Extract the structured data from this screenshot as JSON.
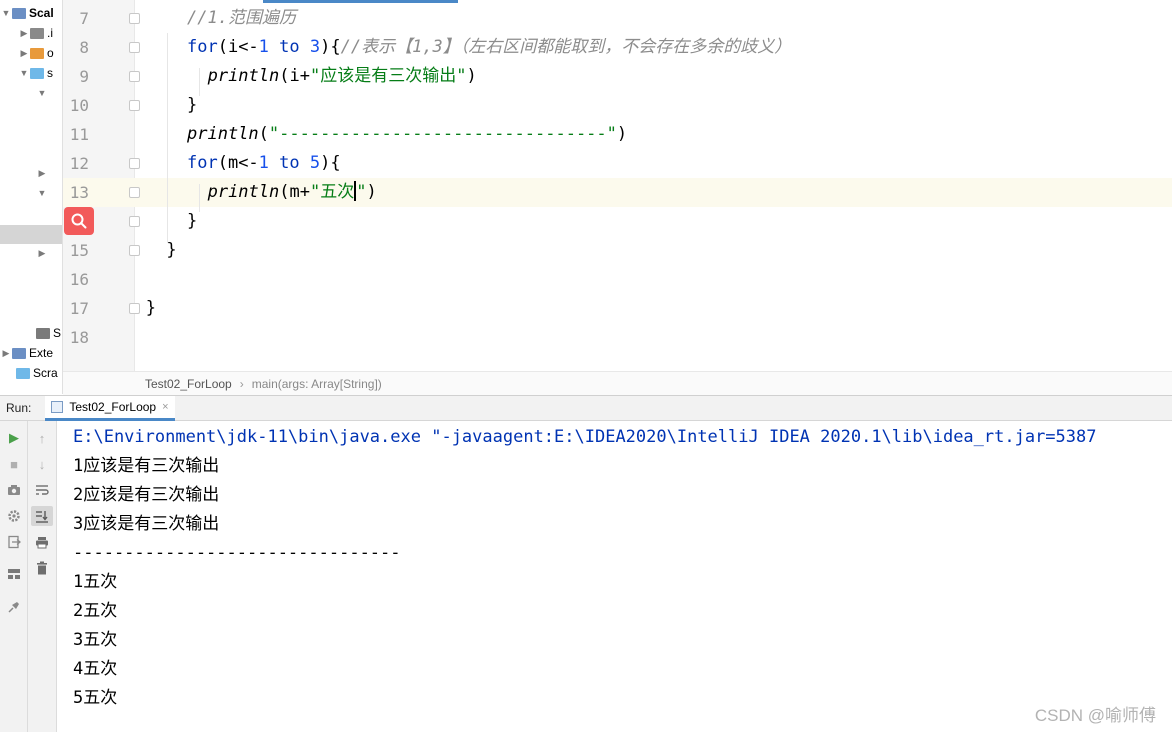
{
  "project_tree": {
    "items": [
      {
        "arrow": "▼",
        "icon_color": "#6b8fc4",
        "label": "Scal",
        "bold": true
      },
      {
        "arrow": "▶",
        "icon_color": "#8a8a8a",
        "label": ".i",
        "bold": false
      },
      {
        "arrow": "▶",
        "icon_color": "#e89a3c",
        "label": "o",
        "bold": false
      },
      {
        "arrow": "▼",
        "icon_color": "#6fb8e8",
        "label": "s",
        "bold": false
      },
      {
        "arrow": "▼",
        "icon_color": "",
        "label": "",
        "bold": false
      },
      {
        "arrow": "▶",
        "icon_color": "",
        "label": "",
        "bold": false
      },
      {
        "arrow": "▼",
        "icon_color": "",
        "label": "",
        "bold": false
      },
      {
        "arrow": "▶",
        "icon_color": "",
        "label": "",
        "bold": false
      },
      {
        "arrow": "",
        "icon_color": "#7a7a7a",
        "label": "S",
        "bold": false
      },
      {
        "arrow": "▶",
        "icon_color": "#6b8fc4",
        "label": "Exte",
        "bold": false
      },
      {
        "arrow": "",
        "icon_color": "#6fb8e8",
        "label": "Scra",
        "bold": false
      }
    ]
  },
  "editor": {
    "lines": [
      {
        "num": "7"
      },
      {
        "num": "8"
      },
      {
        "num": "9"
      },
      {
        "num": "10"
      },
      {
        "num": "11"
      },
      {
        "num": "12"
      },
      {
        "num": "13"
      },
      {
        "num": "14"
      },
      {
        "num": "15"
      },
      {
        "num": "16"
      },
      {
        "num": "17"
      },
      {
        "num": "18"
      }
    ],
    "code": {
      "l7_comment": "//1.范围遍历",
      "l8_for": "for",
      "l8_a": "(i<-",
      "l8_n1": "1",
      "l8_to": " to ",
      "l8_n2": "3",
      "l8_b": "){",
      "l8_comment": "//表示【1,3】（左右区间都能取到，不会存在多余的歧义）",
      "l9_fn": "println",
      "l9_a": "(i+",
      "l9_str": "\"应该是有三次输出\"",
      "l9_b": ")",
      "l10": "}",
      "l11_fn": "println",
      "l11_a": "(",
      "l11_str": "\"--------------------------------\"",
      "l11_b": ")",
      "l12_for": "for",
      "l12_a": "(m<-",
      "l12_n1": "1",
      "l12_to": " to ",
      "l12_n2": "5",
      "l12_b": "){",
      "l13_fn": "println",
      "l13_a": "(m+",
      "l13_str1": "\"五次",
      "l13_str2": "\"",
      "l13_b": ")",
      "l14": "}",
      "l15": "}",
      "l17": "}"
    }
  },
  "breadcrumb": {
    "object": "Test02_ForLoop",
    "method": "main(args: Array[String])"
  },
  "run_panel": {
    "label": "Run:",
    "tab_label": "Test02_ForLoop",
    "tab_close": "×",
    "console_lines": [
      "E:\\Environment\\jdk-11\\bin\\java.exe \"-javaagent:E:\\IDEA2020\\IntelliJ IDEA 2020.1\\lib\\idea_rt.jar=5387",
      "1应该是有三次输出",
      "2应该是有三次输出",
      "3应该是有三次输出",
      "--------------------------------",
      "1五次",
      "2五次",
      "3五次",
      "4五次",
      "5五次"
    ]
  },
  "watermark": "CSDN @喻师傅",
  "colors": {
    "keyword": "#0033b3",
    "string": "#067d17",
    "number": "#1750eb",
    "comment": "#8c8c8c",
    "current_line": "#fcfaed",
    "run_green": "#4aa04a"
  }
}
